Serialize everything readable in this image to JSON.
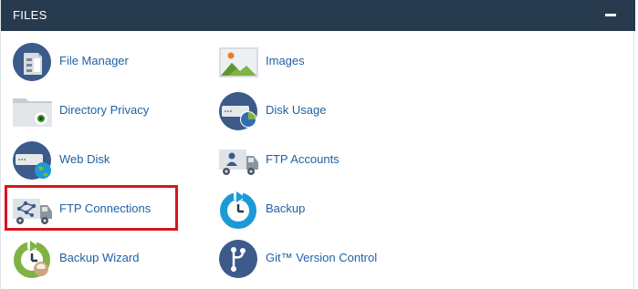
{
  "section": {
    "title": "FILES",
    "collapse_icon": "minus-icon"
  },
  "items": [
    {
      "label": "File Manager",
      "icon": "file-manager-icon"
    },
    {
      "label": "Images",
      "icon": "images-icon"
    },
    {
      "label": "Directory Privacy",
      "icon": "directory-privacy-icon"
    },
    {
      "label": "Disk Usage",
      "icon": "disk-usage-icon"
    },
    {
      "label": "Web Disk",
      "icon": "web-disk-icon"
    },
    {
      "label": "FTP Accounts",
      "icon": "ftp-accounts-icon"
    },
    {
      "label": "FTP Connections",
      "icon": "ftp-connections-icon"
    },
    {
      "label": "Backup",
      "icon": "backup-icon"
    },
    {
      "label": "Backup Wizard",
      "icon": "backup-wizard-icon"
    },
    {
      "label": "Git™ Version Control",
      "icon": "git-version-control-icon"
    }
  ],
  "colors": {
    "header_bg": "#283b4e",
    "link": "#1f62a4",
    "highlight": "#d9141e",
    "icon_navy": "#3c5a8a",
    "icon_blue": "#1b9ad6"
  }
}
